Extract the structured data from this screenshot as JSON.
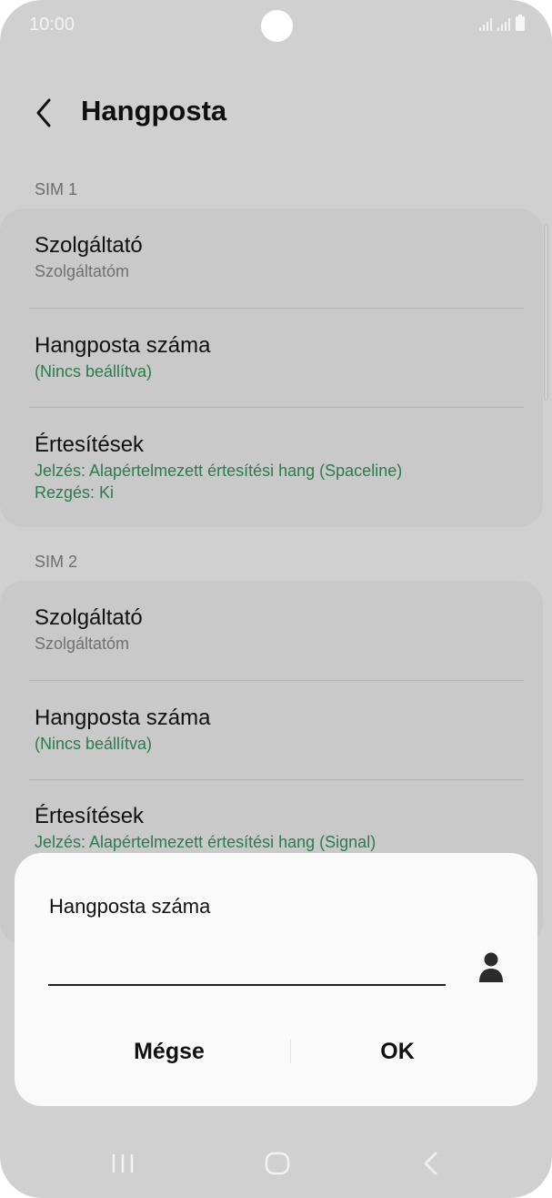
{
  "status_bar": {
    "time": "10:00"
  },
  "header": {
    "title": "Hangposta"
  },
  "sim1": {
    "label": "SIM 1",
    "items": [
      {
        "title": "Szolgáltató",
        "subtitle": "Szolgáltatóm"
      },
      {
        "title": "Hangposta száma",
        "subtitle": "(Nincs beállítva)"
      },
      {
        "title": "Értesítések",
        "subtitle": "Jelzés: Alapértelmezett értesítési hang (Spaceline)",
        "subtitle2": "Rezgés: Ki"
      }
    ]
  },
  "sim2": {
    "label": "SIM 2",
    "items": [
      {
        "title": "Szolgáltató",
        "subtitle": "Szolgáltatóm"
      },
      {
        "title": "Hangposta száma",
        "subtitle": "(Nincs beállítva)"
      },
      {
        "title": "Értesítések",
        "subtitle": "Jelzés: Alapértelmezett értesítési hang (Signal)"
      }
    ]
  },
  "dialog": {
    "title": "Hangposta száma",
    "input_value": "",
    "cancel_label": "Mégse",
    "ok_label": "OK"
  },
  "colors": {
    "background": "#d0d0d0",
    "card": "#c9c9c9",
    "accent_green": "#2c7a4b",
    "dialog": "#fafafa"
  },
  "icons": {
    "back": "chevron-left-icon",
    "contact": "person-icon",
    "nav_recent": "recent-apps-icon",
    "nav_home": "home-icon",
    "nav_back": "back-icon"
  }
}
